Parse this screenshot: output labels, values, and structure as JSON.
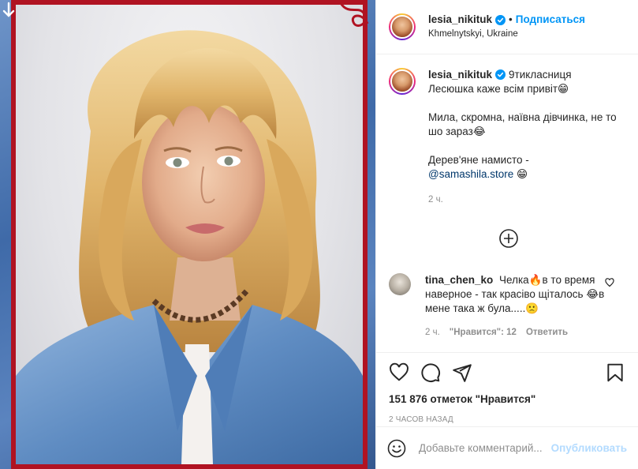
{
  "post": {
    "photo": {
      "icon": "down-arrow-icon",
      "frame_color": "#b01322",
      "background": "#4a73b0"
    },
    "header": {
      "username": "lesia_nikituk",
      "follow_label": "Подписаться",
      "location": "Khmelnytskyi, Ukraine",
      "verified_icon": "verified-badge-icon"
    },
    "caption": {
      "username": "lesia_nikituk",
      "line1": "9тикласниця",
      "line2": "Лесюшка каже всім привіт😁",
      "para2": "Мила, скромна, наївна дівчинка, не то шо зараз😂",
      "para3_prefix": "Дерев'яне намисто -",
      "mention": "@samashila.store",
      "mention_emoji": "😁",
      "time": "2 ч."
    },
    "comment": {
      "username": "tina_chen_ko",
      "text": "Челка🔥в то время наверное - так красіво щіталось 😂в мене така ж була.....🙁",
      "time": "2 ч.",
      "likes_label": "\"Нравится\": 12",
      "reply_label": "Ответить"
    },
    "actions": {
      "likes": "151 876 отметок \"Нравится\"",
      "posted_ago": "2 ЧАСОВ НАЗАД",
      "icons": [
        "heart-icon",
        "comment-icon",
        "share-icon",
        "bookmark-icon"
      ]
    },
    "add_comment": {
      "placeholder": "Добавьте комментарий...",
      "publish_label": "Опубликовать"
    },
    "colors": {
      "accent": "#0095f6",
      "muted": "#8e8e8e",
      "publish_disabled": "#b3dbff"
    }
  }
}
